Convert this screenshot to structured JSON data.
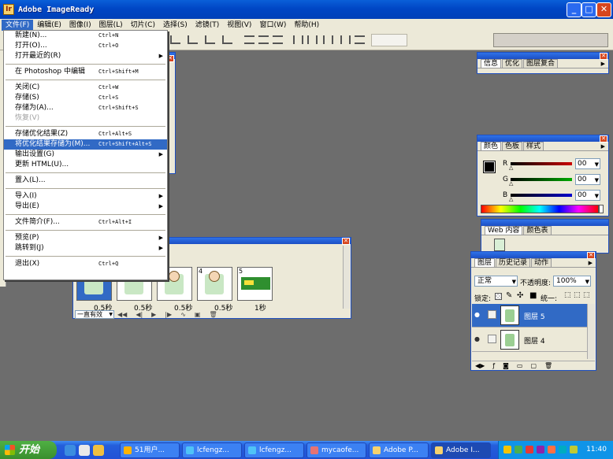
{
  "window": {
    "title": "Adobe ImageReady"
  },
  "menubar": [
    {
      "label": "文件(F)",
      "active": true
    },
    {
      "label": "编辑(E)"
    },
    {
      "label": "图像(I)"
    },
    {
      "label": "图层(L)"
    },
    {
      "label": "切片(C)"
    },
    {
      "label": "选择(S)"
    },
    {
      "label": "滤镜(T)"
    },
    {
      "label": "视图(V)"
    },
    {
      "label": "窗口(W)"
    },
    {
      "label": "帮助(H)"
    }
  ],
  "file_menu": [
    {
      "label": "新建(N)...",
      "shortcut": "Ctrl+N"
    },
    {
      "label": "打开(O)...",
      "shortcut": "Ctrl+O"
    },
    {
      "label": "打开最近的(R)",
      "submenu": true
    },
    {
      "sep": true
    },
    {
      "label": "在 Photoshop 中编辑",
      "shortcut": "Ctrl+Shift+M"
    },
    {
      "sep": true
    },
    {
      "label": "关闭(C)",
      "shortcut": "Ctrl+W"
    },
    {
      "label": "存储(S)",
      "shortcut": "Ctrl+S"
    },
    {
      "label": "存储为(A)...",
      "shortcut": "Ctrl+Shift+S"
    },
    {
      "label": "恢复(V)",
      "disabled": true
    },
    {
      "sep": true
    },
    {
      "label": "存储优化结果(Z)",
      "shortcut": "Ctrl+Alt+S"
    },
    {
      "label": "将优化结果存储为(M)...",
      "shortcut": "Ctrl+Shift+Alt+S",
      "highlighted": true
    },
    {
      "label": "输出设置(G)",
      "submenu": true
    },
    {
      "label": "更新 HTML(U)..."
    },
    {
      "sep": true
    },
    {
      "label": "置入(L)..."
    },
    {
      "sep": true
    },
    {
      "label": "导入(I)",
      "submenu": true
    },
    {
      "label": "导出(E)",
      "submenu": true
    },
    {
      "sep": true
    },
    {
      "label": "文件简介(F)...",
      "shortcut": "Ctrl+Alt+I"
    },
    {
      "sep": true
    },
    {
      "label": "预览(P)",
      "submenu": true
    },
    {
      "label": "跳转到(J)",
      "submenu": true
    },
    {
      "sep": true
    },
    {
      "label": "退出(X)",
      "shortcut": "Ctrl+Q"
    }
  ],
  "info_panel": {
    "tabs": [
      "信息",
      "优化",
      "图层复合"
    ]
  },
  "color_panel": {
    "tabs": [
      "颜色",
      "色板",
      "样式"
    ],
    "channels": [
      {
        "label": "R",
        "value": "00",
        "color": "#cc0000"
      },
      {
        "label": "G",
        "value": "00",
        "color": "#00aa00"
      },
      {
        "label": "B",
        "value": "00",
        "color": "#0000cc"
      }
    ]
  },
  "web_panel": {
    "tabs": [
      "Web 内容",
      "颜色表"
    ]
  },
  "layers_panel": {
    "tabs": [
      "图层",
      "历史记录",
      "动作"
    ],
    "blend_mode": "正常",
    "opacity_label": "不透明度:",
    "opacity": "100%",
    "lock_label": "锁定:",
    "unify_label": "统一:",
    "layers": [
      {
        "name": "图层 5",
        "selected": true
      },
      {
        "name": "图层 4",
        "selected": false
      }
    ]
  },
  "animation_panel": {
    "frames": [
      {
        "num": "",
        "delay": "0.5秒"
      },
      {
        "num": "",
        "delay": "0.5秒"
      },
      {
        "num": "",
        "delay": "0.5秒"
      },
      {
        "num": "4",
        "delay": "0.5秒"
      },
      {
        "num": "5",
        "delay": "1秒"
      }
    ],
    "loop": "一直有效"
  },
  "taskbar": {
    "start_label": "开始",
    "tasks": [
      {
        "label": "51用户..."
      },
      {
        "label": "lcfengz..."
      },
      {
        "label": "lcfengz..."
      },
      {
        "label": "mycaofe..."
      },
      {
        "label": "Adobe P..."
      },
      {
        "label": "Adobe I...",
        "active": true
      }
    ],
    "clock": "11:40"
  }
}
